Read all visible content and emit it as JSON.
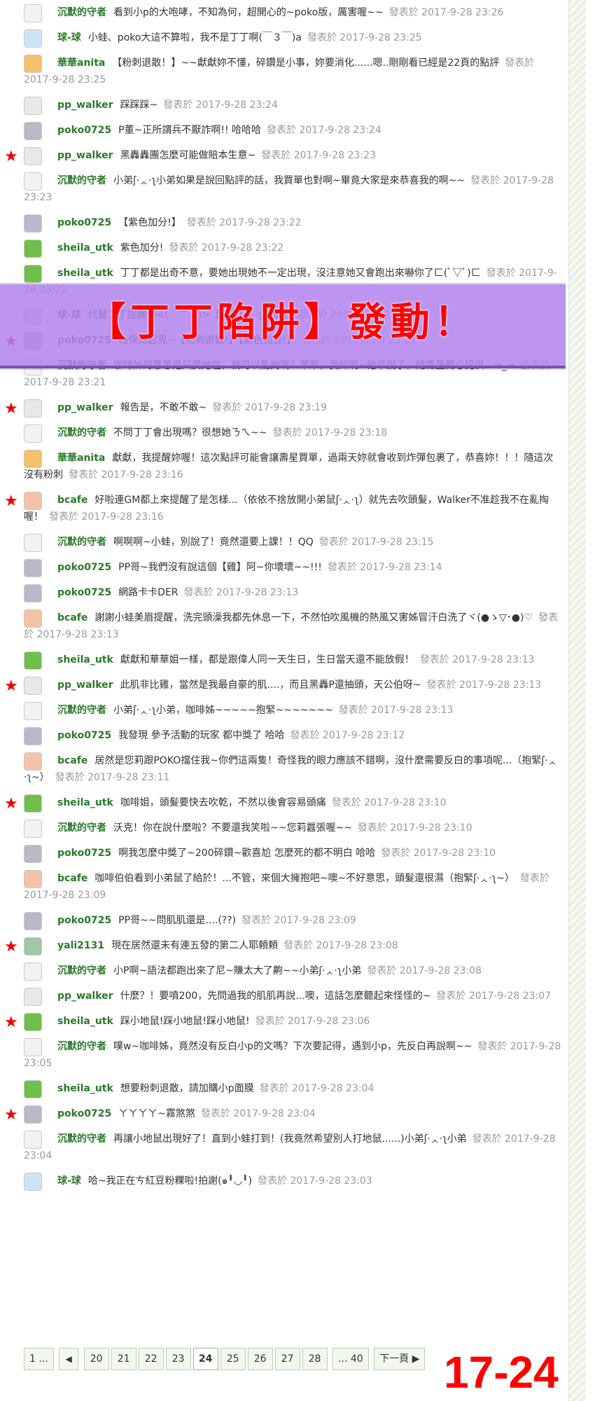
{
  "posts": [
    {
      "star": false,
      "avatar_color": "#f2f2f2",
      "name": "沉默的守者",
      "message": "看到小p的大咆哮，不知為何，超開心的~poko版，厲害喔~~",
      "time": "發表於 2017-9-28 23:26"
    },
    {
      "star": false,
      "avatar_color": "#cfe3f7",
      "name": "球-球",
      "message": "小蛙、poko大這不算啦，我不是丁丁啊(￣３￣)a",
      "time": "發表於 2017-9-28 23:25"
    },
    {
      "star": false,
      "avatar_color": "#f4c06a",
      "name": "華華anita",
      "message": "【粉刺退散！】~~獻獻妳不懂，碎鑽是小事，妳要消化......嗯..剛剛看已經是22頁的點評",
      "time": "發表於 2017-9-28 23:25"
    },
    {
      "star": false,
      "avatar_color": "#e8e8e8",
      "name": "pp_walker",
      "message": "踩踩踩~",
      "time": "發表於 2017-9-28 23:24"
    },
    {
      "star": false,
      "avatar_color": "#b9b9c9",
      "name": "poko0725",
      "message": "P董~正所謂兵不厭詐啊!! 哈哈哈",
      "time": "發表於 2017-9-28 23:24"
    },
    {
      "star": true,
      "avatar_color": "#e8e8e8",
      "name": "pp_walker",
      "message": "黑轟轟團怎麼可能做賠本生意~",
      "time": "發表於 2017-9-28 23:23"
    },
    {
      "star": false,
      "avatar_color": "#f2f2f2",
      "name": "沉默的守者",
      "message": "小弟ʃ·ᆺ·ʅ小弟如果是說回點評的話，我買單也對啊~畢竟大家是來恭喜我的啊~~",
      "time": "發表於 2017-9-28 23:23"
    },
    {
      "star": false,
      "avatar_color": "#b9b9c9",
      "name": "poko0725",
      "message": "【紫色加分!】",
      "time": "發表於 2017-9-28 23:22"
    },
    {
      "star": false,
      "avatar_color": "#6fbf4a",
      "name": "sheila_utk",
      "message": "紫色加分!",
      "time": "發表於 2017-9-28 23:22"
    },
    {
      "star": false,
      "avatar_color": "#6fbf4a",
      "name": "sheila_utk",
      "message": "丁丁都是出奇不意，要她出現她不一定出現，沒注意她又會跑出來嚇你了ㄈ(ﾟ▽ﾟ)ㄈ",
      "time": "發表於 2017-9-28 23:22"
    },
    {
      "star": false,
      "avatar_color": "#cfe3f7",
      "name": "球-球",
      "message": "代替丁丁提醒你<(￣︶￣)>【丁丁ʃ·ᆺ·ʅ出現】",
      "time": "發表於 2017-9-28 23:22"
    },
    {
      "star": true,
      "avatar_color": "#b9b9c9",
      "name": "poko0725",
      "message": "為保險起見~【粉刺退散!】【紫色加分!】",
      "time": "發表於 2017-9-28 23:21"
    },
    {
      "star": false,
      "avatar_color": "#f2f2f2",
      "name": "沉默的守者",
      "message": "咖啡姊的意思是只要她在，就可以亂掏嗎？華華，我知啊~他早說了，隨需量開心提供...→_→",
      "time": "發表於 2017-9-28 23:21"
    },
    {
      "star": true,
      "avatar_color": "#e8e8e8",
      "name": "pp_walker",
      "message": "報告是，不敢不敢~",
      "time": "發表於 2017-9-28 23:19"
    },
    {
      "star": false,
      "avatar_color": "#f2f2f2",
      "name": "沉默的守者",
      "message": "不問丁丁會出現嗎？很想她ㄋㄟ~~",
      "time": "發表於 2017-9-28 23:18"
    },
    {
      "star": false,
      "avatar_color": "#f4c06a",
      "name": "華華anita",
      "message": "獻獻，我提醒妳喔！這次點評可能會讓壽星買單，過兩天妳就會收到炸彈包裹了，恭喜妳！！！隨這次沒有粉刺",
      "time": "發表於 2017-9-28 23:16"
    },
    {
      "star": true,
      "avatar_color": "#f3c3a8",
      "name": "bcafe",
      "message": "好啦連GM都上來提醒了是怎樣...（依依不捨放開小弟鼠ʃ·ᆺ·ʅ）就先去吹頭髮，Walker不准趁我不在亂掏喔！",
      "time": "發表於 2017-9-28 23:16"
    },
    {
      "star": false,
      "avatar_color": "#f2f2f2",
      "name": "沉默的守者",
      "message": "啊啊啊~小蛙，別說了！竟然還要上課！！QQ",
      "time": "發表於 2017-9-28 23:15"
    },
    {
      "star": false,
      "avatar_color": "#b9b9c9",
      "name": "poko0725",
      "message": "PP哥~我們沒有說這個【雞】阿~你壞壞~~!!!",
      "time": "發表於 2017-9-28 23:14"
    },
    {
      "star": false,
      "avatar_color": "#b9b9c9",
      "name": "poko0725",
      "message": "網路卡卡DER",
      "time": "發表於 2017-9-28 23:13"
    },
    {
      "star": false,
      "avatar_color": "#f3c3a8",
      "name": "bcafe",
      "message": "謝謝小蛙美眉提醒，洗完頭澡我都先休息一下，不然怕吹風機的熱風又害姊冒汗白洗了ヾ(●ゝ▽･●)♡",
      "time": "發表於 2017-9-28 23:13"
    },
    {
      "star": false,
      "avatar_color": "#6fbf4a",
      "name": "sheila_utk",
      "message": "獻獻和華華姐一樣，都是跟偉人同一天生日，生日當天還不能放假！",
      "time": "發表於 2017-9-28 23:13"
    },
    {
      "star": true,
      "avatar_color": "#e8e8e8",
      "name": "pp_walker",
      "message": "此肌非比雞，當然是我最自豪的肌....，而且黑轟P還抽頭，天公伯呀~",
      "time": "發表於 2017-9-28 23:13"
    },
    {
      "star": false,
      "avatar_color": "#f2f2f2",
      "name": "沉默的守者",
      "message": "小弟ʃ·ᆺ·ʅ小弟，咖啡姊~~~~~抱緊~~~~~~~",
      "time": "發表於 2017-9-28 23:13"
    },
    {
      "star": false,
      "avatar_color": "#b9b9c9",
      "name": "poko0725",
      "message": "我發現 參予活動的玩家 都中獎了 哈哈",
      "time": "發表於 2017-9-28 23:12"
    },
    {
      "star": false,
      "avatar_color": "#f3c3a8",
      "name": "bcafe",
      "message": "居然是您莉跟POKO擋住我~你們這兩隻！奇怪我的眼力應該不錯啊，沒什麼需要反白的事項呢...（抱緊ʃ·ᆺ·ʅ~）",
      "time": "發表於 2017-9-28 23:11"
    },
    {
      "star": true,
      "avatar_color": "#6fbf4a",
      "name": "sheila_utk",
      "message": "咖啡姐，頭髮要快去吹乾，不然以後會容易頭痛",
      "time": "發表於 2017-9-28 23:10"
    },
    {
      "star": false,
      "avatar_color": "#f2f2f2",
      "name": "沉默的守者",
      "message": "沃克！你在說什麼啦？不要還我笑啦~~您莉囂張喔~~",
      "time": "發表於 2017-9-28 23:10"
    },
    {
      "star": false,
      "avatar_color": "#b9b9c9",
      "name": "poko0725",
      "message": "啊我怎麼中獎了~200碎鑽~歡喜尬 怎麼死的都不明白 哈哈",
      "time": "發表於 2017-9-28 23:10"
    },
    {
      "star": false,
      "avatar_color": "#f3c3a8",
      "name": "bcafe",
      "message": "咖啡伯伯看到小弟鼠了給於！...不管，來個大擁抱吧~噢~不好意思，頭髮還很濕（抱緊ʃ·ᆺ·ʅ~）",
      "time": "發表於 2017-9-28 23:09"
    },
    {
      "star": false,
      "avatar_color": "#b9b9c9",
      "name": "poko0725",
      "message": "PP哥~~問肌肌還是....(??)",
      "time": "發表於 2017-9-28 23:09"
    },
    {
      "star": true,
      "avatar_color": "#9fc7a8",
      "name": "yali2131",
      "message": "現在居然還未有連五發的第二人耶頼頼",
      "time": "發表於 2017-9-28 23:08"
    },
    {
      "star": false,
      "avatar_color": "#f2f2f2",
      "name": "沉默的守者",
      "message": "小P啊~語法都跑出來了尼~賺太大了齁~~小弟ʃ·ᆺ·ʅ小弟",
      "time": "發表於 2017-9-28 23:08"
    },
    {
      "star": false,
      "avatar_color": "#e8e8e8",
      "name": "pp_walker",
      "message": "什麼？！要噴200，先問過我的肌肌再說...噢，這話怎麼聽起來怪怪的~",
      "time": "發表於 2017-9-28 23:07"
    },
    {
      "star": true,
      "avatar_color": "#6fbf4a",
      "name": "sheila_utk",
      "message": "踩小地鼠!踩小地鼠!踩小地鼠!",
      "time": "發表於 2017-9-28 23:06"
    },
    {
      "star": false,
      "avatar_color": "#f2f2f2",
      "name": "沉默的守者",
      "message": "噗w~咖啡姊，竟然沒有反白小p的文嗎？下次要記得，遇到小p，先反白再說啊~~",
      "time": "發表於 2017-9-28 23:05"
    },
    {
      "star": false,
      "avatar_color": "#6fbf4a",
      "name": "sheila_utk",
      "message": "想要粉刺退散，請加購小p面膜",
      "time": "發表於 2017-9-28 23:04"
    },
    {
      "star": true,
      "avatar_color": "#b9b9c9",
      "name": "poko0725",
      "message": "ㄚㄚㄚㄚ~霧煞煞",
      "time": "發表於 2017-9-28 23:04"
    },
    {
      "star": false,
      "avatar_color": "#f2f2f2",
      "name": "沉默的守者",
      "message": "再讓小地鼠出現好了！直到小蛙打到！(我竟然希望別人打地鼠......)小弟ʃ·ᆺ·ʅ小弟",
      "time": "發表於 2017-9-28 23:04"
    },
    {
      "star": false,
      "avatar_color": "#cfe3f7",
      "name": "球-球",
      "message": "哈~我正在ㄘ紅豆粉粿啦!拍謝(๑╹◡╹)",
      "time": "發表於 2017-9-28 23:03"
    }
  ],
  "banner": {
    "text": "【丁丁陷阱】發動！"
  },
  "pagination": {
    "first": "1 ...",
    "prev_icon": "◀",
    "pages": [
      "20",
      "21",
      "22",
      "23",
      "24",
      "25",
      "26",
      "27",
      "28"
    ],
    "current": "24",
    "last": "... 40",
    "next": "下一頁 ▶"
  },
  "page_range": "17-24",
  "colors": {
    "name": "#2a7a2a",
    "star": "#ee0000",
    "banner_bg": "#b182ed",
    "banner_text": "#ff0000"
  }
}
